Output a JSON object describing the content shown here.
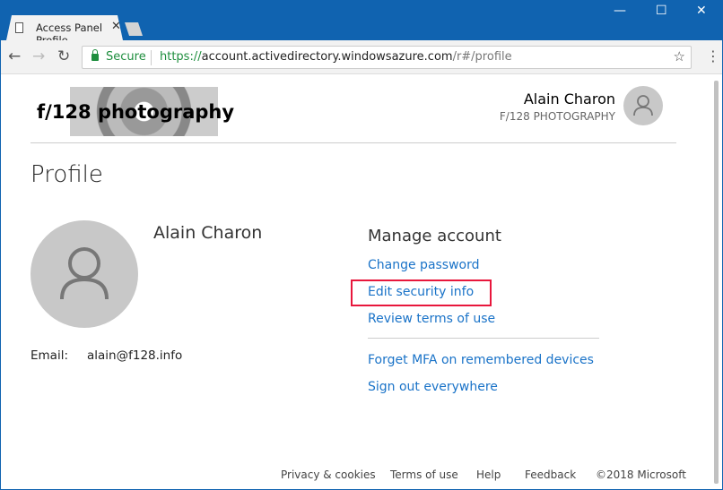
{
  "browser": {
    "tab_title": "Access Panel Profile",
    "secure_label": "Secure",
    "url_scheme": "https://",
    "url_host": "account.activedirectory.windowsazure.com",
    "url_path": "/r#/profile"
  },
  "header": {
    "logo_text": "f/128 photography",
    "user_name": "Alain Charon",
    "org_name": "F/128 PHOTOGRAPHY"
  },
  "profile": {
    "title": "Profile",
    "name": "Alain Charon",
    "email_label": "Email:",
    "email": "alain@f128.info"
  },
  "manage": {
    "title": "Manage account",
    "links": [
      "Change password",
      "Edit security info",
      "Review terms of use",
      "Forget MFA on remembered devices",
      "Sign out everywhere"
    ],
    "highlight_color": "#e8173c"
  },
  "footer": {
    "links": [
      "Privacy & cookies",
      "Terms of use",
      "Help",
      "Feedback"
    ],
    "copyright": "©2018 Microsoft"
  },
  "colors": {
    "titlebar": "#1063b0",
    "link": "#1a73c8"
  }
}
